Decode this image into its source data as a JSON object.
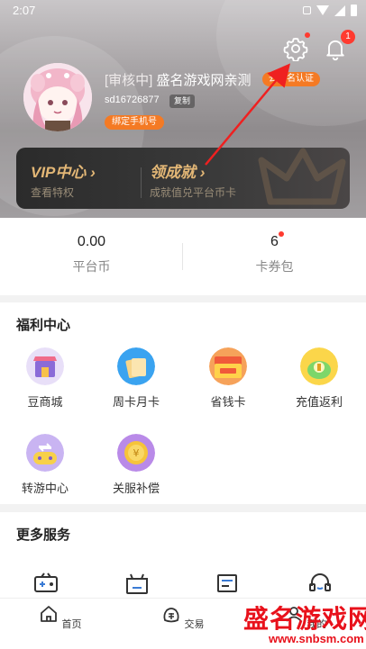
{
  "status_bar": {
    "time": "2:07"
  },
  "header": {
    "notification_count": "1",
    "review_tag": "[审核中]",
    "username": "盛名游戏网亲测",
    "verify_label": "去实名认证",
    "uid": "sd16726877",
    "copy_label": "复制",
    "bind_phone_label": "绑定手机号"
  },
  "vip_card": {
    "vip_title": "VIP中心",
    "vip_sub": "查看特权",
    "achievement_title": "领成就",
    "achievement_sub": "成就值兑平台币卡"
  },
  "stats": [
    {
      "value": "0.00",
      "label": "平台币"
    },
    {
      "value": "6",
      "label": "卡券包"
    }
  ],
  "welfare": {
    "title": "福利中心",
    "items": [
      {
        "label": "豆商城",
        "icon": "bean-shop-icon"
      },
      {
        "label": "周卡月卡",
        "icon": "weekly-monthly-card-icon"
      },
      {
        "label": "省钱卡",
        "icon": "save-money-card-icon"
      },
      {
        "label": "充值返利",
        "icon": "recharge-rebate-icon"
      },
      {
        "label": "转游中心",
        "icon": "game-transfer-icon"
      },
      {
        "label": "关服补偿",
        "icon": "server-close-compensation-icon"
      }
    ]
  },
  "services": {
    "title": "更多服务"
  },
  "tabbar": [
    {
      "label": "首页",
      "icon": "home-icon"
    },
    {
      "label": "交易",
      "icon": "trade-bag-icon"
    },
    {
      "label": "我的",
      "icon": "profile-icon"
    }
  ],
  "watermark": {
    "title": "盛名游戏网",
    "url": "www.snbsm.com"
  },
  "colors": {
    "accent": "#f47a24",
    "gold": "#e3b776",
    "badge": "#ff3b30",
    "watermark": "#e8111b"
  }
}
